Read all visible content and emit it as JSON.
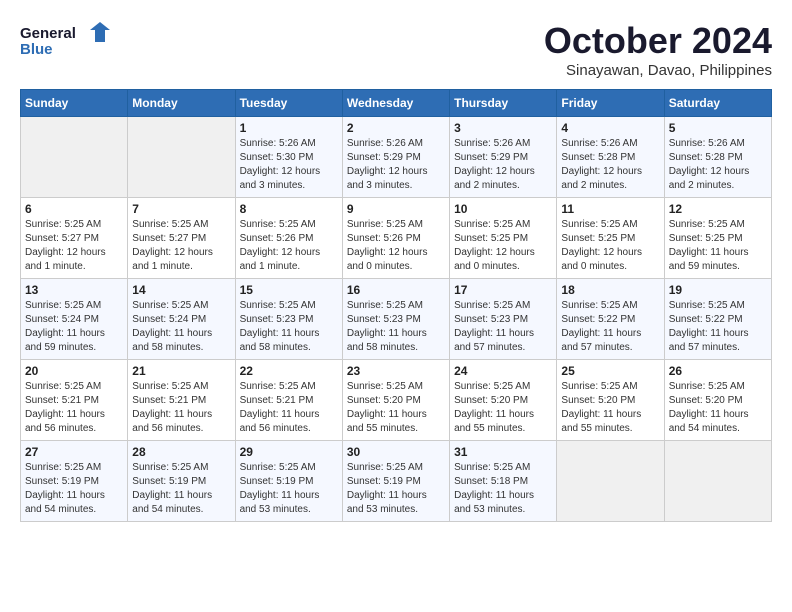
{
  "logo": {
    "line1": "General",
    "line2": "Blue"
  },
  "title": "October 2024",
  "subtitle": "Sinayawan, Davao, Philippines",
  "days_of_week": [
    "Sunday",
    "Monday",
    "Tuesday",
    "Wednesday",
    "Thursday",
    "Friday",
    "Saturday"
  ],
  "weeks": [
    [
      {
        "day": "",
        "info": ""
      },
      {
        "day": "",
        "info": ""
      },
      {
        "day": "1",
        "info": "Sunrise: 5:26 AM\nSunset: 5:30 PM\nDaylight: 12 hours and 3 minutes."
      },
      {
        "day": "2",
        "info": "Sunrise: 5:26 AM\nSunset: 5:29 PM\nDaylight: 12 hours and 3 minutes."
      },
      {
        "day": "3",
        "info": "Sunrise: 5:26 AM\nSunset: 5:29 PM\nDaylight: 12 hours and 2 minutes."
      },
      {
        "day": "4",
        "info": "Sunrise: 5:26 AM\nSunset: 5:28 PM\nDaylight: 12 hours and 2 minutes."
      },
      {
        "day": "5",
        "info": "Sunrise: 5:26 AM\nSunset: 5:28 PM\nDaylight: 12 hours and 2 minutes."
      }
    ],
    [
      {
        "day": "6",
        "info": "Sunrise: 5:25 AM\nSunset: 5:27 PM\nDaylight: 12 hours and 1 minute."
      },
      {
        "day": "7",
        "info": "Sunrise: 5:25 AM\nSunset: 5:27 PM\nDaylight: 12 hours and 1 minute."
      },
      {
        "day": "8",
        "info": "Sunrise: 5:25 AM\nSunset: 5:26 PM\nDaylight: 12 hours and 1 minute."
      },
      {
        "day": "9",
        "info": "Sunrise: 5:25 AM\nSunset: 5:26 PM\nDaylight: 12 hours and 0 minutes."
      },
      {
        "day": "10",
        "info": "Sunrise: 5:25 AM\nSunset: 5:25 PM\nDaylight: 12 hours and 0 minutes."
      },
      {
        "day": "11",
        "info": "Sunrise: 5:25 AM\nSunset: 5:25 PM\nDaylight: 12 hours and 0 minutes."
      },
      {
        "day": "12",
        "info": "Sunrise: 5:25 AM\nSunset: 5:25 PM\nDaylight: 11 hours and 59 minutes."
      }
    ],
    [
      {
        "day": "13",
        "info": "Sunrise: 5:25 AM\nSunset: 5:24 PM\nDaylight: 11 hours and 59 minutes."
      },
      {
        "day": "14",
        "info": "Sunrise: 5:25 AM\nSunset: 5:24 PM\nDaylight: 11 hours and 58 minutes."
      },
      {
        "day": "15",
        "info": "Sunrise: 5:25 AM\nSunset: 5:23 PM\nDaylight: 11 hours and 58 minutes."
      },
      {
        "day": "16",
        "info": "Sunrise: 5:25 AM\nSunset: 5:23 PM\nDaylight: 11 hours and 58 minutes."
      },
      {
        "day": "17",
        "info": "Sunrise: 5:25 AM\nSunset: 5:23 PM\nDaylight: 11 hours and 57 minutes."
      },
      {
        "day": "18",
        "info": "Sunrise: 5:25 AM\nSunset: 5:22 PM\nDaylight: 11 hours and 57 minutes."
      },
      {
        "day": "19",
        "info": "Sunrise: 5:25 AM\nSunset: 5:22 PM\nDaylight: 11 hours and 57 minutes."
      }
    ],
    [
      {
        "day": "20",
        "info": "Sunrise: 5:25 AM\nSunset: 5:21 PM\nDaylight: 11 hours and 56 minutes."
      },
      {
        "day": "21",
        "info": "Sunrise: 5:25 AM\nSunset: 5:21 PM\nDaylight: 11 hours and 56 minutes."
      },
      {
        "day": "22",
        "info": "Sunrise: 5:25 AM\nSunset: 5:21 PM\nDaylight: 11 hours and 56 minutes."
      },
      {
        "day": "23",
        "info": "Sunrise: 5:25 AM\nSunset: 5:20 PM\nDaylight: 11 hours and 55 minutes."
      },
      {
        "day": "24",
        "info": "Sunrise: 5:25 AM\nSunset: 5:20 PM\nDaylight: 11 hours and 55 minutes."
      },
      {
        "day": "25",
        "info": "Sunrise: 5:25 AM\nSunset: 5:20 PM\nDaylight: 11 hours and 55 minutes."
      },
      {
        "day": "26",
        "info": "Sunrise: 5:25 AM\nSunset: 5:20 PM\nDaylight: 11 hours and 54 minutes."
      }
    ],
    [
      {
        "day": "27",
        "info": "Sunrise: 5:25 AM\nSunset: 5:19 PM\nDaylight: 11 hours and 54 minutes."
      },
      {
        "day": "28",
        "info": "Sunrise: 5:25 AM\nSunset: 5:19 PM\nDaylight: 11 hours and 54 minutes."
      },
      {
        "day": "29",
        "info": "Sunrise: 5:25 AM\nSunset: 5:19 PM\nDaylight: 11 hours and 53 minutes."
      },
      {
        "day": "30",
        "info": "Sunrise: 5:25 AM\nSunset: 5:19 PM\nDaylight: 11 hours and 53 minutes."
      },
      {
        "day": "31",
        "info": "Sunrise: 5:25 AM\nSunset: 5:18 PM\nDaylight: 11 hours and 53 minutes."
      },
      {
        "day": "",
        "info": ""
      },
      {
        "day": "",
        "info": ""
      }
    ]
  ]
}
